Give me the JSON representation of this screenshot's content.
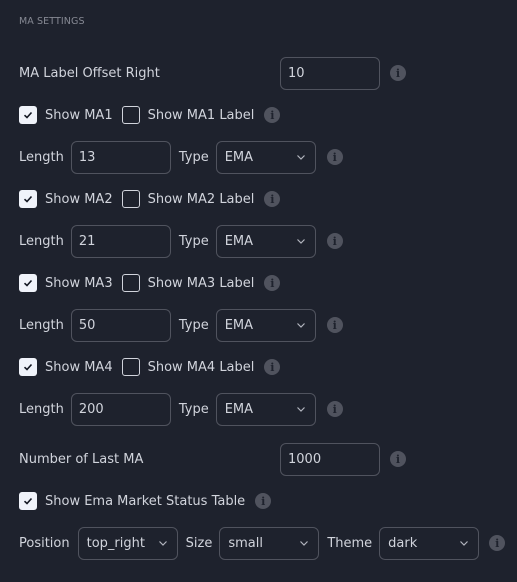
{
  "section": {
    "title": "MA SETTINGS"
  },
  "offset": {
    "label": "MA Label Offset Right",
    "value": "10"
  },
  "ma": [
    {
      "show_label": "Show MA1",
      "show_checked": true,
      "label_label": "Show MA1 Label",
      "label_checked": false,
      "length_label": "Length",
      "length": "13",
      "type_label": "Type",
      "type": "EMA"
    },
    {
      "show_label": "Show MA2",
      "show_checked": true,
      "label_label": "Show MA2 Label",
      "label_checked": false,
      "length_label": "Length",
      "length": "21",
      "type_label": "Type",
      "type": "EMA"
    },
    {
      "show_label": "Show MA3",
      "show_checked": true,
      "label_label": "Show MA3 Label",
      "label_checked": false,
      "length_label": "Length",
      "length": "50",
      "type_label": "Type",
      "type": "EMA"
    },
    {
      "show_label": "Show MA4",
      "show_checked": true,
      "label_label": "Show MA4 Label",
      "label_checked": false,
      "length_label": "Length",
      "length": "200",
      "type_label": "Type",
      "type": "EMA"
    }
  ],
  "last_ma": {
    "label": "Number of Last MA",
    "value": "1000"
  },
  "status_table": {
    "label": "Show Ema Market Status Table",
    "checked": true
  },
  "table_opts": {
    "position_label": "Position",
    "position": "top_right",
    "size_label": "Size",
    "size": "small",
    "theme_label": "Theme",
    "theme": "dark"
  },
  "icons": {
    "info": "i"
  }
}
